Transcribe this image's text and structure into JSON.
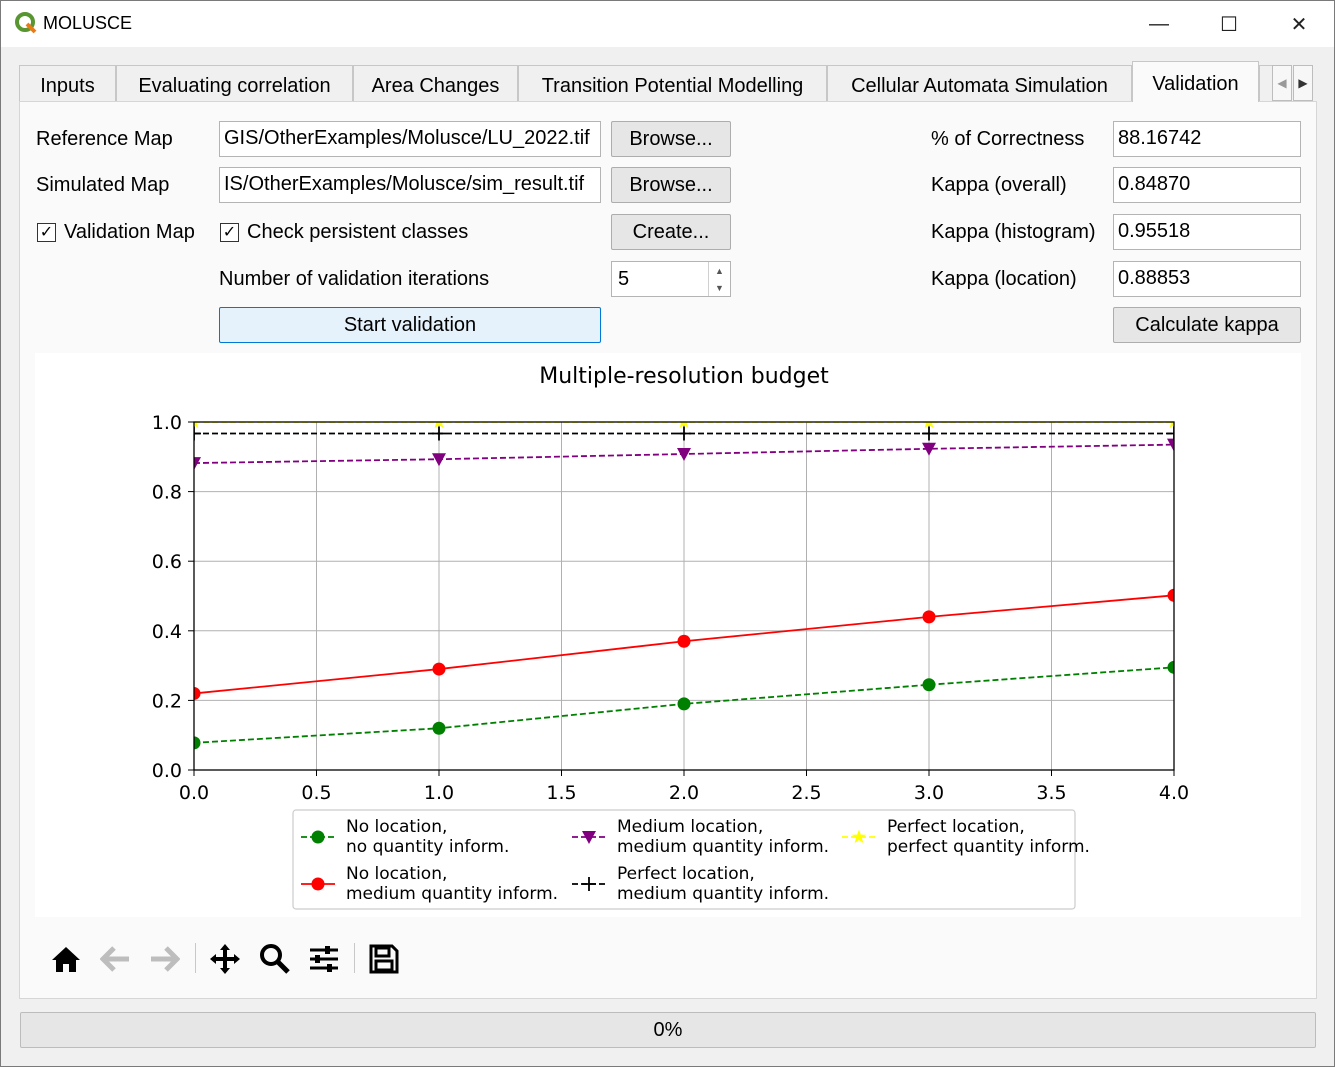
{
  "window": {
    "title": "MOLUSCE",
    "minimize": "—",
    "maximize": "☐",
    "close": "✕"
  },
  "tabs": [
    {
      "label": "Inputs"
    },
    {
      "label": "Evaluating correlation"
    },
    {
      "label": "Area Changes"
    },
    {
      "label": "Transition Potential Modelling"
    },
    {
      "label": "Cellular Automata Simulation"
    },
    {
      "label": "Validation",
      "active": true
    }
  ],
  "form": {
    "reference_map_label": "Reference Map",
    "reference_map_value": "GIS/OtherExamples/Molusce/LU_2022.tif",
    "simulated_map_label": "Simulated Map",
    "simulated_map_value": "IS/OtherExamples/Molusce/sim_result.tif",
    "browse_label": "Browse...",
    "validation_map_label": "Validation Map",
    "validation_map_checked": true,
    "persistent_label": "Check persistent classes",
    "persistent_checked": true,
    "create_label": "Create...",
    "iterations_label": "Number of validation iterations",
    "iterations_value": "5",
    "start_label": "Start validation"
  },
  "stats": {
    "correctness_label": "% of Correctness",
    "correctness_value": "88.16742",
    "kappa_overall_label": "Kappa (overall)",
    "kappa_overall_value": "0.84870",
    "kappa_hist_label": "Kappa (histogram)",
    "kappa_hist_value": "0.95518",
    "kappa_loc_label": "Kappa (location)",
    "kappa_loc_value": "0.88853",
    "calc_label": "Calculate kappa"
  },
  "chart_data": {
    "type": "line",
    "title": "Multiple-resolution budget",
    "xlabel": "",
    "ylabel": "",
    "xlim": [
      0,
      4
    ],
    "ylim": [
      0,
      1
    ],
    "x_ticks": [
      "0.0",
      "0.5",
      "1.0",
      "1.5",
      "2.0",
      "2.5",
      "3.0",
      "3.5",
      "4.0"
    ],
    "y_ticks": [
      "0.0",
      "0.2",
      "0.4",
      "0.6",
      "0.8",
      "1.0"
    ],
    "grid": true,
    "legend_position": "bottom",
    "x": [
      0,
      1,
      2,
      3,
      4
    ],
    "series": [
      {
        "name": "No location,\nno quantity inform.",
        "values": [
          0.078,
          0.12,
          0.19,
          0.245,
          0.295
        ],
        "color": "#008000",
        "style": "dashed",
        "marker": "circle"
      },
      {
        "name": "No location,\nmedium quantity inform.",
        "values": [
          0.22,
          0.29,
          0.37,
          0.44,
          0.502
        ],
        "color": "#ff0000",
        "style": "solid",
        "marker": "circle"
      },
      {
        "name": "Medium location,\nmedium quantity inform.",
        "values": [
          0.882,
          0.893,
          0.908,
          0.923,
          0.935
        ],
        "color": "#800080",
        "style": "dashed",
        "marker": "triangle-down"
      },
      {
        "name": "Perfect location,\nmedium quantity inform.",
        "values": [
          0.967,
          0.967,
          0.967,
          0.967,
          0.967
        ],
        "color": "#000000",
        "style": "dashed",
        "marker": "plus"
      },
      {
        "name": "Perfect location,\nperfect quantity inform.",
        "values": [
          1.0,
          1.0,
          1.0,
          1.0,
          1.0
        ],
        "color": "#ffff00",
        "style": "dashed",
        "marker": "star"
      }
    ]
  },
  "toolbar": {
    "icons": [
      "home-icon",
      "back-arrow-icon",
      "forward-arrow-icon",
      "pan-icon",
      "zoom-icon",
      "configure-subplots-icon",
      "save-icon"
    ]
  },
  "progress": {
    "value": 0,
    "label": "0%"
  }
}
